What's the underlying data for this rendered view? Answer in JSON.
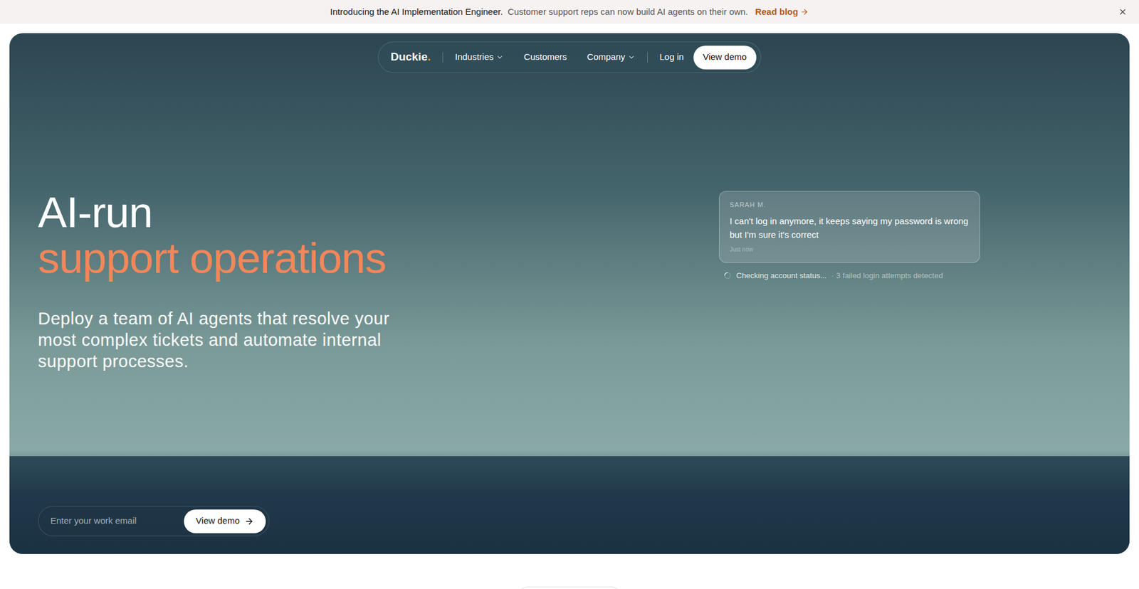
{
  "banner": {
    "headline": "Introducing the AI Implementation Engineer.",
    "text": "Customer support reps can now build AI agents on their own.",
    "link": "Read blog"
  },
  "nav": {
    "logo": "Duckie",
    "logo_dot": ".",
    "items": [
      {
        "label": "Industries",
        "dropdown": true
      },
      {
        "label": "Customers",
        "dropdown": false
      },
      {
        "label": "Company",
        "dropdown": true
      }
    ],
    "login": "Log in",
    "cta": "View demo"
  },
  "hero": {
    "title_line1": "AI-run",
    "title_line2": "support operations",
    "subtitle": "Deploy a team of AI agents that resolve your most complex tickets and automate internal support processes."
  },
  "chat": {
    "sender": "SARAH M.",
    "message": "I can't log in anymore, it keeps saying my password is wrong but I'm sure it's correct",
    "time": "Just now",
    "status": "Checking account status...",
    "detail": "· 3 failed login attempts detected"
  },
  "form": {
    "placeholder": "Enter your work email",
    "button": "View demo"
  }
}
